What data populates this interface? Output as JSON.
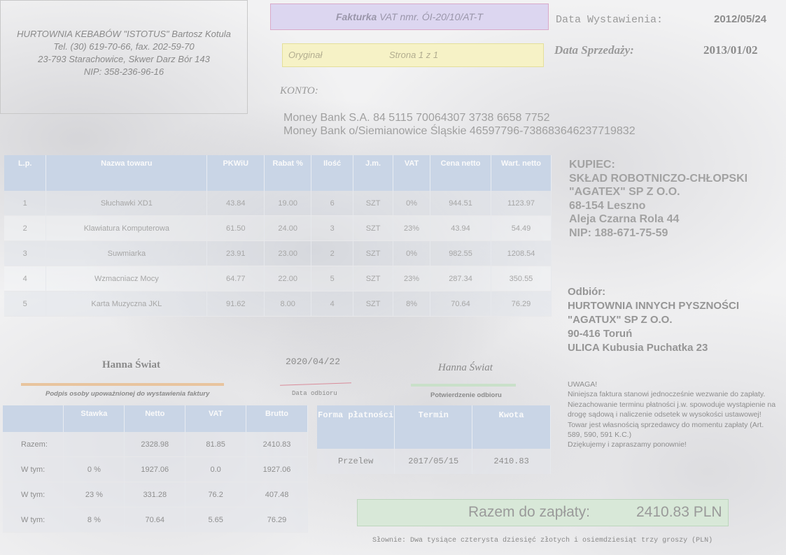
{
  "seller": {
    "line1": "HURTOWNIA KEBABÓW \"ISTOTUS\" Bartosz Kotula",
    "line2": "Tel. (30) 619-70-66, fax. 202-59-70",
    "line3": "23-793 Starachowice, Skwer Darz Bór 143",
    "line4": "NIP: 358-236-96-16"
  },
  "invoice": {
    "title_bold": "Fakturka",
    "title_rest": " VAT nmr. ÓI-20/10/AT-T",
    "original": "Oryginał",
    "page": "Strona 1 z 1",
    "issue_label": "Data Wystawienia:",
    "issue_date": "2012/05/24",
    "sale_label": "Data Sprzedaży:",
    "sale_date": "2013/01/02"
  },
  "bank": {
    "label": "KONTO:",
    "account1": "Money Bank S.A. 84 5115 70064307 3738 6658 7752",
    "account2": "Money Bank  o/Siemianowice Śląskie 46597796-738683646237719832"
  },
  "items_table": {
    "headers": [
      "L.p.",
      "Nazwa towaru",
      "PKWiU",
      "Rabat %",
      "Ilość",
      "J.m.",
      "VAT",
      "Cena netto",
      "Wart. netto"
    ],
    "rows": [
      [
        "1",
        "Słuchawki XD1",
        "43.84",
        "19.00",
        "6",
        "SZT",
        "0%",
        "944.51",
        "1123.97"
      ],
      [
        "2",
        "Klawiatura Komputerowa",
        "61.50",
        "24.00",
        "3",
        "SZT",
        "23%",
        "43.94",
        "54.49"
      ],
      [
        "3",
        "Suwmiarka",
        "23.91",
        "23.00",
        "2",
        "SZT",
        "0%",
        "982.55",
        "1208.54"
      ],
      [
        "4",
        "Wzmacniacz Mocy",
        "64.77",
        "22.00",
        "5",
        "SZT",
        "23%",
        "287.34",
        "350.55"
      ],
      [
        "5",
        "Karta Muzyczna JKL",
        "91.62",
        "8.00",
        "4",
        "SZT",
        "8%",
        "70.64",
        "76.29"
      ]
    ]
  },
  "buyer": {
    "label": "KUPIEC:",
    "line1": "SKŁAD ROBOTNICZO-CHŁOPSKI",
    "line2": "\"AGATEX\" SP Z O.O.",
    "line3": "68-154 Leszno",
    "line4": "Aleja  Czarna Rola 44",
    "line5": "NIP: 188-671-75-59"
  },
  "receiver": {
    "label": "Odbiór:",
    "line1": "HURTOWNIA INNYCH PYSZNOŚCI",
    "line2": "\"AGATUX\" SP Z O.O.",
    "line3": "90-416 Toruń",
    "line4": "ULICA Kubusia Puchatka 23"
  },
  "notice": {
    "title": "UWAGA!",
    "body": "Niniejsza faktura stanowi jednocześnie wezwanie do zapłaty. Niezachowanie terminu płatności j.w. spowoduje wystąpienie na drogę sądową i naliczenie odsetek w wysokości ustawowej! Towar jest własnością sprzedawcy do momentu zapłaty (Art. 589, 590, 591 K.C.)",
    "thanks": "Dziękujemy i zapraszamy ponownie!"
  },
  "signatures": {
    "issuer_name": "Hanna Świat",
    "issuer_caption": "Podpis osoby upoważnionej do wystawienia faktury",
    "receipt_date": "2020/04/22",
    "date_caption": "Data odbioru",
    "confirm_name": "Hanna Świat",
    "confirm_caption": "Potwierdzenie odbioru"
  },
  "vat_table": {
    "headers": [
      "",
      "Stawka",
      "Netto",
      "VAT",
      "Brutto"
    ],
    "rows": [
      [
        "Razem:",
        "",
        "2328.98",
        "81.85",
        "2410.83"
      ],
      [
        "W tym:",
        "0 %",
        "1927.06",
        "0.0",
        "1927.06"
      ],
      [
        "W tym:",
        "23 %",
        "331.28",
        "76.2",
        "407.48"
      ],
      [
        "W tym:",
        "8 %",
        "70.64",
        "5.65",
        "76.29"
      ]
    ]
  },
  "payment_table": {
    "headers": [
      "Forma płatności",
      "Termin",
      "Kwota"
    ],
    "rows": [
      [
        "Przelew",
        "2017/05/15",
        "2410.83"
      ]
    ]
  },
  "total": {
    "label": "Razem do zapłaty:",
    "value": "2410.83 PLN",
    "words": "Słownie: Dwa tysiące czterysta dziesięć złotych i osiemdziesiąt trzy groszy (PLN)"
  }
}
